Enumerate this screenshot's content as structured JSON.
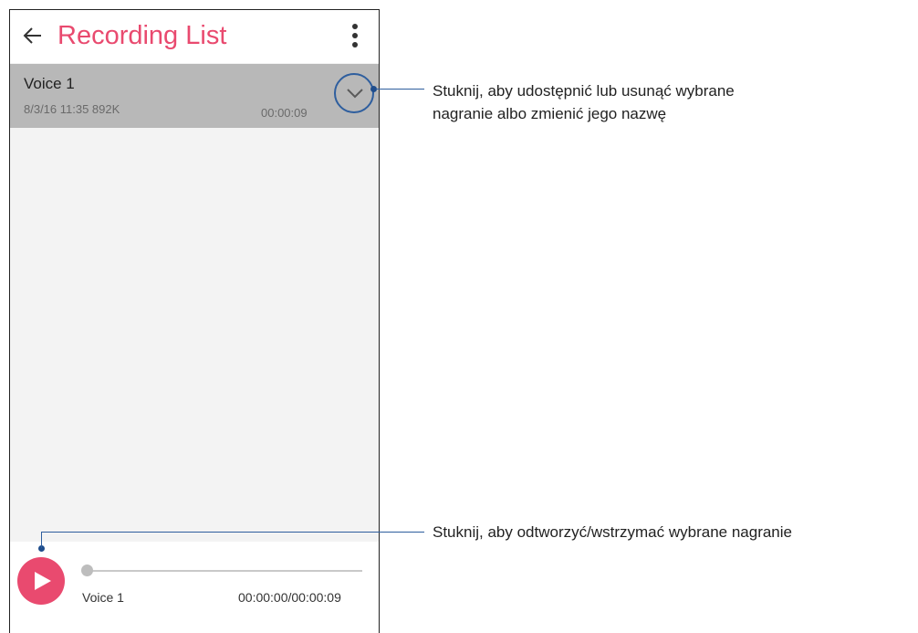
{
  "appbar": {
    "title": "Recording List",
    "back_icon": "arrow-left-icon",
    "menu_icon": "more-vert-icon"
  },
  "recordings": [
    {
      "name": "Voice 1",
      "meta": "8/3/16 11:35  892K",
      "duration": "00:00:09",
      "expand_icon": "chevron-down-icon"
    }
  ],
  "player": {
    "play_icon": "play-icon",
    "track_name": "Voice 1",
    "time": "00:00:00/00:00:09",
    "progress": 0
  },
  "callouts": {
    "expand": {
      "line1": "Stuknij, aby udostępnić lub usunąć wybrane",
      "line2": "nagranie albo zmienić jego nazwę"
    },
    "play": {
      "line1": "Stuknij, aby odtworzyć/wstrzymać wybrane nagranie"
    }
  },
  "colors": {
    "accent": "#e94a6f",
    "callout": "#2e5e9e",
    "selected_row": "#b8b8b8"
  }
}
